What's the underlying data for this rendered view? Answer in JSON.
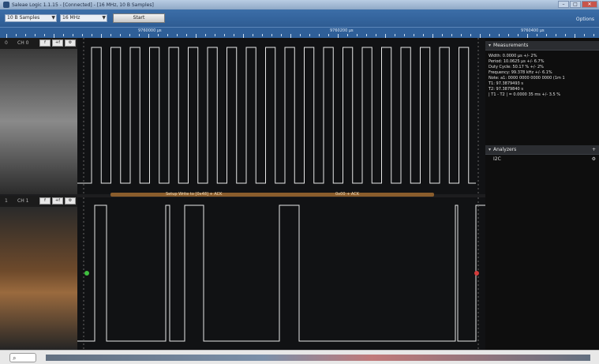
{
  "window": {
    "title": "Saleae Logic 1.1.15 - [Connected] - [16 MHz, 10 B Samples]",
    "minimize": "–",
    "maximize": "□",
    "close": "✕"
  },
  "toolbar": {
    "samples_select": "10 B Samples",
    "rate_select": "16 MHz",
    "start_label": "Start",
    "options_label": "Options"
  },
  "ruler": {
    "labels": [
      "9760000 µs",
      "9760200 µs",
      "9760400 µs"
    ]
  },
  "channels": [
    {
      "number": "0",
      "name": "CH 0",
      "btns": [
        "f",
        "+f"
      ]
    },
    {
      "number": "1",
      "name": "CH 1",
      "btns": [
        "f",
        "+f"
      ]
    }
  ],
  "decode": {
    "segment1": "Setup Write to [0x48] + ACK",
    "segment2": "0x00 + ACK"
  },
  "measurements": {
    "header": "Measurements",
    "lines": [
      "Width:   0.0000 µs +/- 2%",
      "Period:  10.0625 µs +/- 6.7%",
      "Duty Cycle: 50.17 % +/- 2%",
      "Frequency: 99.378 kHz +/- 6.1%",
      "Note:    a1: 0000  0000  0000  0000 (1m 1",
      "T1:      97.3879493 s",
      "T2:      97.3879840 s",
      "| T1 - T2 | = 0.0000 35 ms +/- 3.5 %"
    ]
  },
  "analyzers": {
    "header": "Analyzers",
    "add": "+",
    "items": [
      {
        "name": "I2C",
        "settings": "⚙"
      }
    ]
  },
  "colors": {
    "accent": "#2f5f98",
    "trace": "#e8e8e8",
    "decode": "#8a5d2c",
    "marker_start": "#3fbf3f",
    "marker_end": "#d33b3b"
  }
}
